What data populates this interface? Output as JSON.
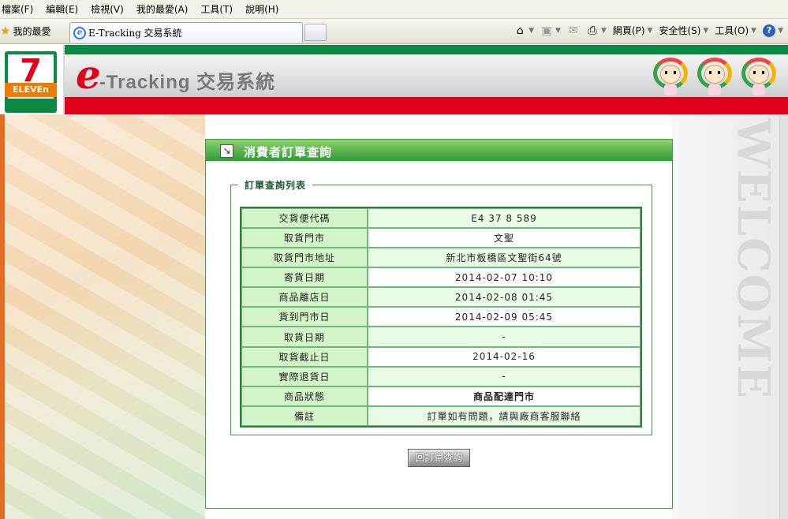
{
  "browser": {
    "menu": [
      "檔案(F)",
      "編輯(E)",
      "檢視(V)",
      "我的最愛(A)",
      "工具(T)",
      "說明(H)"
    ],
    "favorites_label": "我的最愛",
    "tab_title": "E-Tracking 交易系統",
    "tools": {
      "page": "網頁(P)",
      "safety": "安全性(S)",
      "tools": "工具(O)"
    },
    "icons": [
      "home-icon",
      "rss-icon",
      "mail-icon",
      "print-icon",
      "help-icon"
    ]
  },
  "header": {
    "logo_seven": "7",
    "logo_eleven": "ELEVEn",
    "brand_e": "e",
    "brand_rest": "-Tracking 交易系統"
  },
  "side": {
    "welcome": "WELCOME"
  },
  "panel": {
    "title": "消費者訂單查詢",
    "legend": "訂單查詢列表",
    "rows": [
      {
        "label": "交貨便代碼",
        "value": "E4 37 8 589"
      },
      {
        "label": "取貨門市",
        "value": "文聖"
      },
      {
        "label": "取貨門市地址",
        "value": "新北市板橋區文聖街64號"
      },
      {
        "label": "寄貨日期",
        "value": "2014-02-07 10:10"
      },
      {
        "label": "商品離店日",
        "value": "2014-02-08 01:45"
      },
      {
        "label": "貨到門市日",
        "value": "2014-02-09 05:45"
      },
      {
        "label": "取貨日期",
        "value": "-"
      },
      {
        "label": "取貨截止日",
        "value": "2014-02-16"
      },
      {
        "label": "實際退貨日",
        "value": "-"
      },
      {
        "label": "商品狀態",
        "value": "商品配達門市"
      },
      {
        "label": "備註",
        "value": "訂單如有問題，請與廠商客服聯絡"
      }
    ],
    "back_button": "回訂單查詢"
  },
  "colors": {
    "brand_green": "#0b8a43",
    "brand_red": "#e0001c",
    "status_red": "#a80000"
  }
}
